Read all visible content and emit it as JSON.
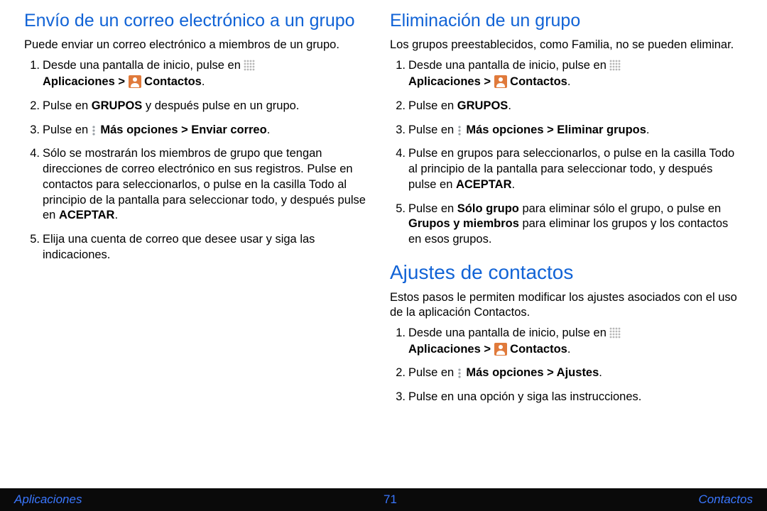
{
  "left": {
    "emailGroup": {
      "title": "Envío de un correo electrónico a un grupo",
      "intro": "Puede enviar un correo electrónico a miembros de un grupo.",
      "steps": {
        "s1a": "Desde una pantalla de inicio, pulse en ",
        "s1b": "Aplicaciones > ",
        "s1c": " Contactos",
        "s1d": ".",
        "s2a": "Pulse en ",
        "s2b": "GRUPOS",
        "s2c": " y después pulse en un grupo.",
        "s3a": "Pulse en ",
        "s3b": " Más opciones > Enviar correo",
        "s3c": ".",
        "s4a": "Sólo se mostrarán los miembros de grupo que tengan direcciones de correo electrónico en sus registros. Pulse en contactos para seleccionarlos, o pulse en la casilla Todo al principio de la pantalla para seleccionar todo, y después pulse en ",
        "s4b": "ACEPTAR",
        "s4c": ".",
        "s5": "Elija una cuenta de correo que desee usar y siga las indicaciones."
      }
    }
  },
  "right": {
    "deleteGroup": {
      "title": "Eliminación de un grupo",
      "intro": "Los grupos preestablecidos, como Familia, no se pueden eliminar.",
      "steps": {
        "s1a": "Desde una pantalla de inicio, pulse en ",
        "s1b": "Aplicaciones > ",
        "s1c": " Contactos",
        "s1d": ".",
        "s2a": "Pulse en ",
        "s2b": "GRUPOS",
        "s2c": ".",
        "s3a": "Pulse en ",
        "s3b": " Más opciones > Eliminar grupos",
        "s3c": ".",
        "s4a": "Pulse en grupos para seleccionarlos, o pulse en la casilla Todo al principio de la pantalla para seleccionar todo, y después pulse en ",
        "s4b": "ACEPTAR",
        "s4c": ".",
        "s5a": "Pulse en ",
        "s5b": "Sólo grupo",
        "s5c": " para eliminar sólo el grupo, o pulse en ",
        "s5d": "Grupos y miembros",
        "s5e": " para eliminar los grupos y los contactos en esos grupos."
      }
    },
    "contactSettings": {
      "title": "Ajustes de contactos",
      "intro": "Estos pasos le permiten modificar los ajustes asociados con el uso de la aplicación Contactos.",
      "steps": {
        "s1a": "Desde una pantalla de inicio, pulse en ",
        "s1b": "Aplicaciones > ",
        "s1c": " Contactos",
        "s1d": ".",
        "s2a": "Pulse en ",
        "s2b": " Más opciones > Ajustes",
        "s2c": ".",
        "s3": "Pulse en una opción y siga las instrucciones."
      }
    }
  },
  "footer": {
    "left": "Aplicaciones",
    "pageNumber": "71",
    "right": "Contactos"
  },
  "icons": {
    "apps": "apps-grid-icon",
    "contact": "person-icon",
    "more": "more-vert-icon"
  }
}
